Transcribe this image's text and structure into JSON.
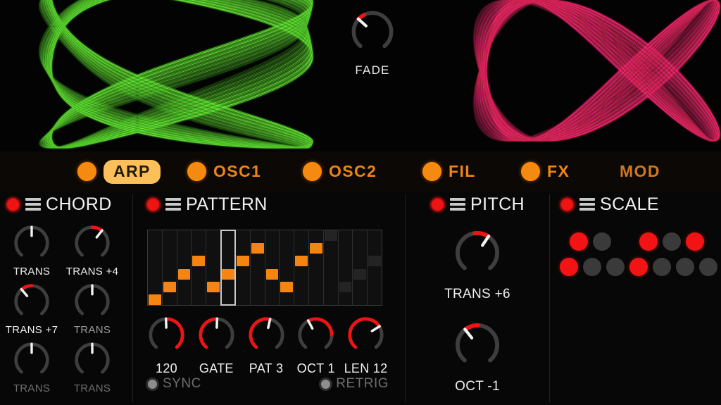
{
  "app": {
    "accent_orange": "#f58410",
    "accent_red": "#ef1414",
    "background": "#060606",
    "tab_active_pill": "#fcc05a"
  },
  "visualizer": {
    "left_scope": {
      "name": "lissajous-green",
      "color": "#3ecf1e",
      "color_bright": "#8de84a"
    },
    "right_scope": {
      "name": "lissajous-pink",
      "color": "#e8126a",
      "color_bright": "#ff2f86",
      "color_dark": "#8a2a12"
    }
  },
  "fade": {
    "label": "FADE",
    "value_angle": -48,
    "arc_sweep": 22
  },
  "tabs": [
    {
      "id": "arp",
      "label": "ARP",
      "active": true,
      "led_on": true
    },
    {
      "id": "osc1",
      "label": "OSC1",
      "active": false,
      "led_on": true
    },
    {
      "id": "osc2",
      "label": "OSC2",
      "active": false,
      "led_on": true
    },
    {
      "id": "fil",
      "label": "FIL",
      "active": false,
      "led_on": true
    },
    {
      "id": "fx",
      "label": "FX",
      "active": false,
      "led_on": true
    },
    {
      "id": "mod",
      "label": "MOD",
      "active": false,
      "led_on": false
    }
  ],
  "chord": {
    "title": "CHORD",
    "led_on": true,
    "knobs": [
      {
        "label": "TRANS",
        "angle": 0,
        "arc": 0,
        "tone": "bright"
      },
      {
        "label": "TRANS +4",
        "angle": 38,
        "arc": 38,
        "tone": "bright"
      },
      {
        "label": "TRANS +7",
        "angle": -40,
        "arc": 40,
        "tone": "bright"
      },
      {
        "label": "TRANS",
        "angle": 0,
        "arc": 0,
        "tone": "mid"
      },
      {
        "label": "TRANS",
        "angle": 0,
        "arc": 0,
        "tone": "dim"
      },
      {
        "label": "TRANS",
        "angle": 0,
        "arc": 0,
        "tone": "dim"
      }
    ]
  },
  "pattern": {
    "title": "PATTERN",
    "led_on": true,
    "sequencer": {
      "steps": 16,
      "levels": 6,
      "cursor_index": 5,
      "active_steps": 12,
      "values": [
        0,
        1,
        2,
        3,
        1,
        2,
        3,
        4,
        2,
        1,
        3,
        4,
        5,
        1,
        2,
        3
      ]
    },
    "knobs": [
      {
        "label": "120",
        "angle": -2,
        "arc": 142
      },
      {
        "label": "GATE",
        "angle": 2,
        "arc": 146
      },
      {
        "label": "PAT 3",
        "angle": 13,
        "arc": 158
      },
      {
        "label": "OCT 1",
        "angle": -28,
        "arc": 118
      },
      {
        "label": "LEN 12",
        "angle": 58,
        "arc": 202
      }
    ],
    "toggles": [
      {
        "id": "sync",
        "label": "SYNC",
        "on": false
      },
      {
        "id": "retrig",
        "label": "RETRIG",
        "on": false
      }
    ]
  },
  "pitch": {
    "title": "PITCH",
    "led_on": true,
    "knobs": [
      {
        "label": "TRANS +6",
        "angle": 34,
        "arc": 42
      },
      {
        "label": "OCT -1",
        "angle": -38,
        "arc": 40
      }
    ]
  },
  "scale": {
    "title": "SCALE",
    "led_on": true,
    "rows": [
      {
        "name": "black-keys",
        "dots": [
          {
            "on": true
          },
          {
            "on": false
          },
          {
            "gap": true
          },
          {
            "on": true
          },
          {
            "on": false
          },
          {
            "on": true
          }
        ]
      },
      {
        "name": "white-keys",
        "dots": [
          {
            "on": true
          },
          {
            "on": false
          },
          {
            "on": false
          },
          {
            "on": true
          },
          {
            "on": false
          },
          {
            "on": false
          },
          {
            "on": false
          }
        ]
      }
    ]
  }
}
